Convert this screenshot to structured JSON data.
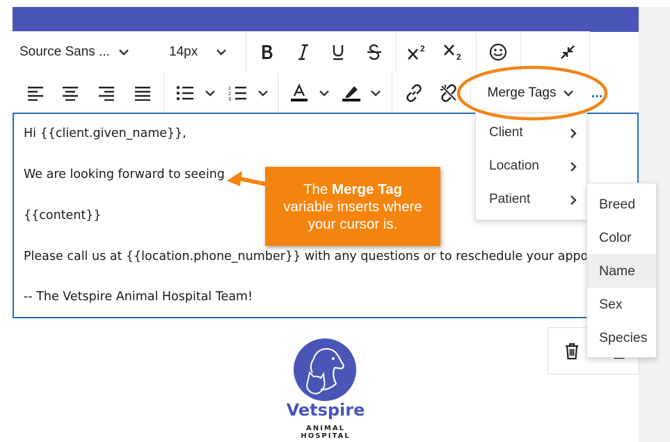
{
  "toolbar": {
    "font_family": "Source Sans ...",
    "font_size": "14px",
    "merge_tags_label": "Merge Tags",
    "more_label": "..."
  },
  "editor": {
    "lines": [
      "Hi {{client.given_name}},",
      "We are looking forward to seeing",
      "{{content}}",
      "Please call us at {{location.phone_number}} with any questions or to reschedule your appointment.",
      "-- The Vetspire Animal Hospital Team!"
    ]
  },
  "merge_menu": {
    "items": [
      "Client",
      "Location",
      "Patient"
    ]
  },
  "patient_submenu": {
    "items": [
      "Breed",
      "Color",
      "Name",
      "Sex",
      "Species"
    ],
    "highlighted": "Name"
  },
  "callout": {
    "prefix": "The ",
    "bold": "Merge Tag",
    "suffix": "variable inserts where your cursor is."
  },
  "logo": {
    "name": "Vetspire",
    "subtitle": "ANIMAL HOSPITAL"
  },
  "colors": {
    "brand": "#4a55b8",
    "focus_border": "#1f6fb8",
    "callout": "#f5840f",
    "highlight_ring": "#f0861a"
  },
  "icons": {
    "row1": [
      "bold-icon",
      "italic-icon",
      "underline-icon",
      "strikethrough-icon",
      "superscript-icon",
      "subscript-icon",
      "emoji-icon",
      "collapse-icon"
    ],
    "row2": [
      "align-left-icon",
      "align-center-icon",
      "align-right-icon",
      "align-justify-icon",
      "bullet-list-icon",
      "numbered-list-icon",
      "text-color-icon",
      "highlight-color-icon",
      "link-icon",
      "unlink-icon"
    ],
    "float": [
      "trash-icon"
    ]
  }
}
